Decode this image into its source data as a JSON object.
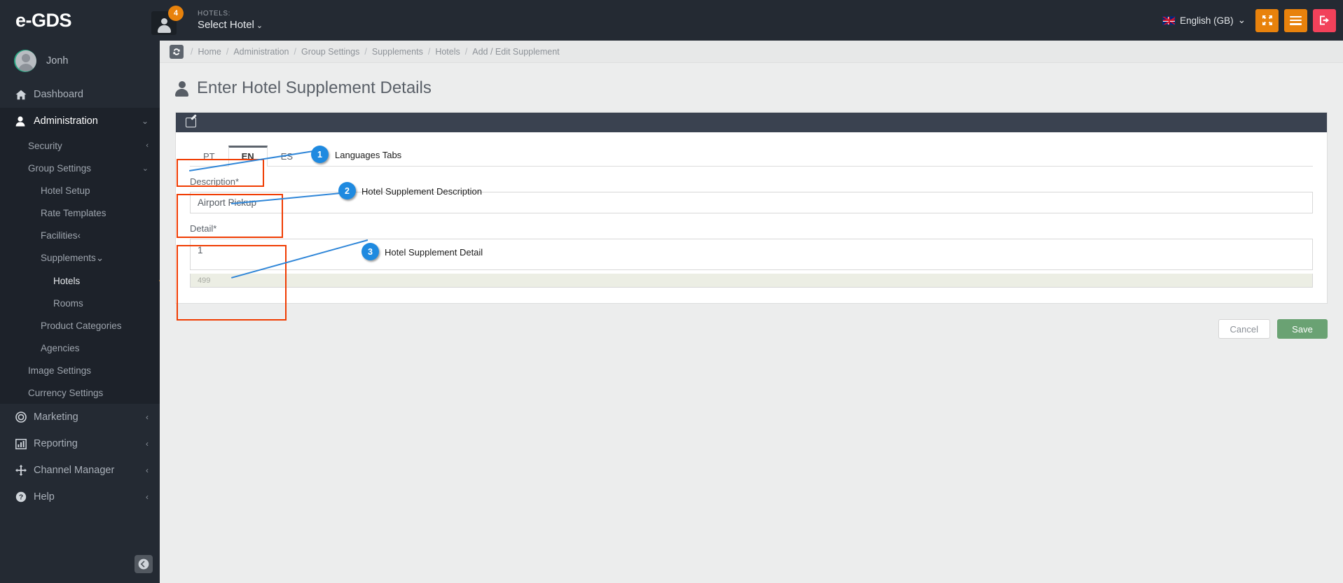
{
  "topbar": {
    "brand": "e-GDS",
    "notification_count": "4",
    "hotels_label": "HOTELS:",
    "hotels_value": "Select Hotel",
    "hotels_caret": "⌄",
    "language": "English (GB)",
    "language_caret": "⌄",
    "buttons": [
      {
        "name": "fullscreen-button",
        "color": "#e8820c"
      },
      {
        "name": "menu-toggle-button",
        "color": "#e8820c"
      },
      {
        "name": "logout-button",
        "color": "#f2415a"
      }
    ]
  },
  "sidebar": {
    "user": "Jonh",
    "items": [
      {
        "label": "Dashboard",
        "icon": "home-icon",
        "arrow": "",
        "level": 0
      },
      {
        "label": "Administration",
        "icon": "user-icon",
        "arrow": "⌄",
        "level": 0,
        "active": true
      },
      {
        "label": "Security",
        "arrow": "‹",
        "level": 1
      },
      {
        "label": "Group Settings",
        "arrow": "⌄",
        "level": 1
      },
      {
        "label": "Hotel Setup",
        "arrow": "",
        "level": 2
      },
      {
        "label": "Rate Templates",
        "arrow": "",
        "level": 2
      },
      {
        "label": "Facilities",
        "arrow": "‹",
        "level": 2
      },
      {
        "label": "Supplements",
        "arrow": "⌄",
        "level": 2
      },
      {
        "label": "Hotels",
        "arrow": "",
        "level": 3,
        "active": true
      },
      {
        "label": "Rooms",
        "arrow": "",
        "level": 3
      },
      {
        "label": "Product Categories",
        "arrow": "",
        "level": 2
      },
      {
        "label": "Agencies",
        "arrow": "",
        "level": 2
      },
      {
        "label": "Image Settings",
        "arrow": "",
        "level": 1
      },
      {
        "label": "Currency Settings",
        "arrow": "",
        "level": 1
      },
      {
        "label": "Marketing",
        "icon": "target-icon",
        "arrow": "‹",
        "level": 0
      },
      {
        "label": "Reporting",
        "icon": "chart-icon",
        "arrow": "‹",
        "level": 0
      },
      {
        "label": "Channel Manager",
        "icon": "move-icon",
        "arrow": "‹",
        "level": 0
      },
      {
        "label": "Help",
        "icon": "question-icon",
        "arrow": "‹",
        "level": 0
      }
    ],
    "collapse_icon": "←"
  },
  "breadcrumb": {
    "refresh_icon": "↻",
    "items": [
      "Home",
      "Administration",
      "Group Settings",
      "Supplements",
      "Hotels",
      "Add / Edit Supplement"
    ]
  },
  "page": {
    "title": "Enter Hotel Supplement Details"
  },
  "form": {
    "tabs": [
      {
        "label": "PT",
        "active": false
      },
      {
        "label": "EN",
        "active": true
      },
      {
        "label": "ES",
        "active": false
      }
    ],
    "description_label": "Description*",
    "description_value": "Airport Pickup",
    "detail_label": "Detail*",
    "detail_value": "1",
    "detail_counter": "499",
    "cancel_label": "Cancel",
    "save_label": "Save"
  },
  "annotations": [
    {
      "number": "1",
      "text": "Languages Tabs"
    },
    {
      "number": "2",
      "text": "Hotel Supplement Description"
    },
    {
      "number": "3",
      "text": "Hotel Supplement Detail"
    }
  ],
  "colors": {
    "accent_orange": "#e8820c",
    "logout_red": "#f2415a",
    "save_green": "#6aa273",
    "sidebar_dark": "#242a33",
    "annotation_box": "#f03c02",
    "annotation_bubble": "#1f8ae0"
  }
}
